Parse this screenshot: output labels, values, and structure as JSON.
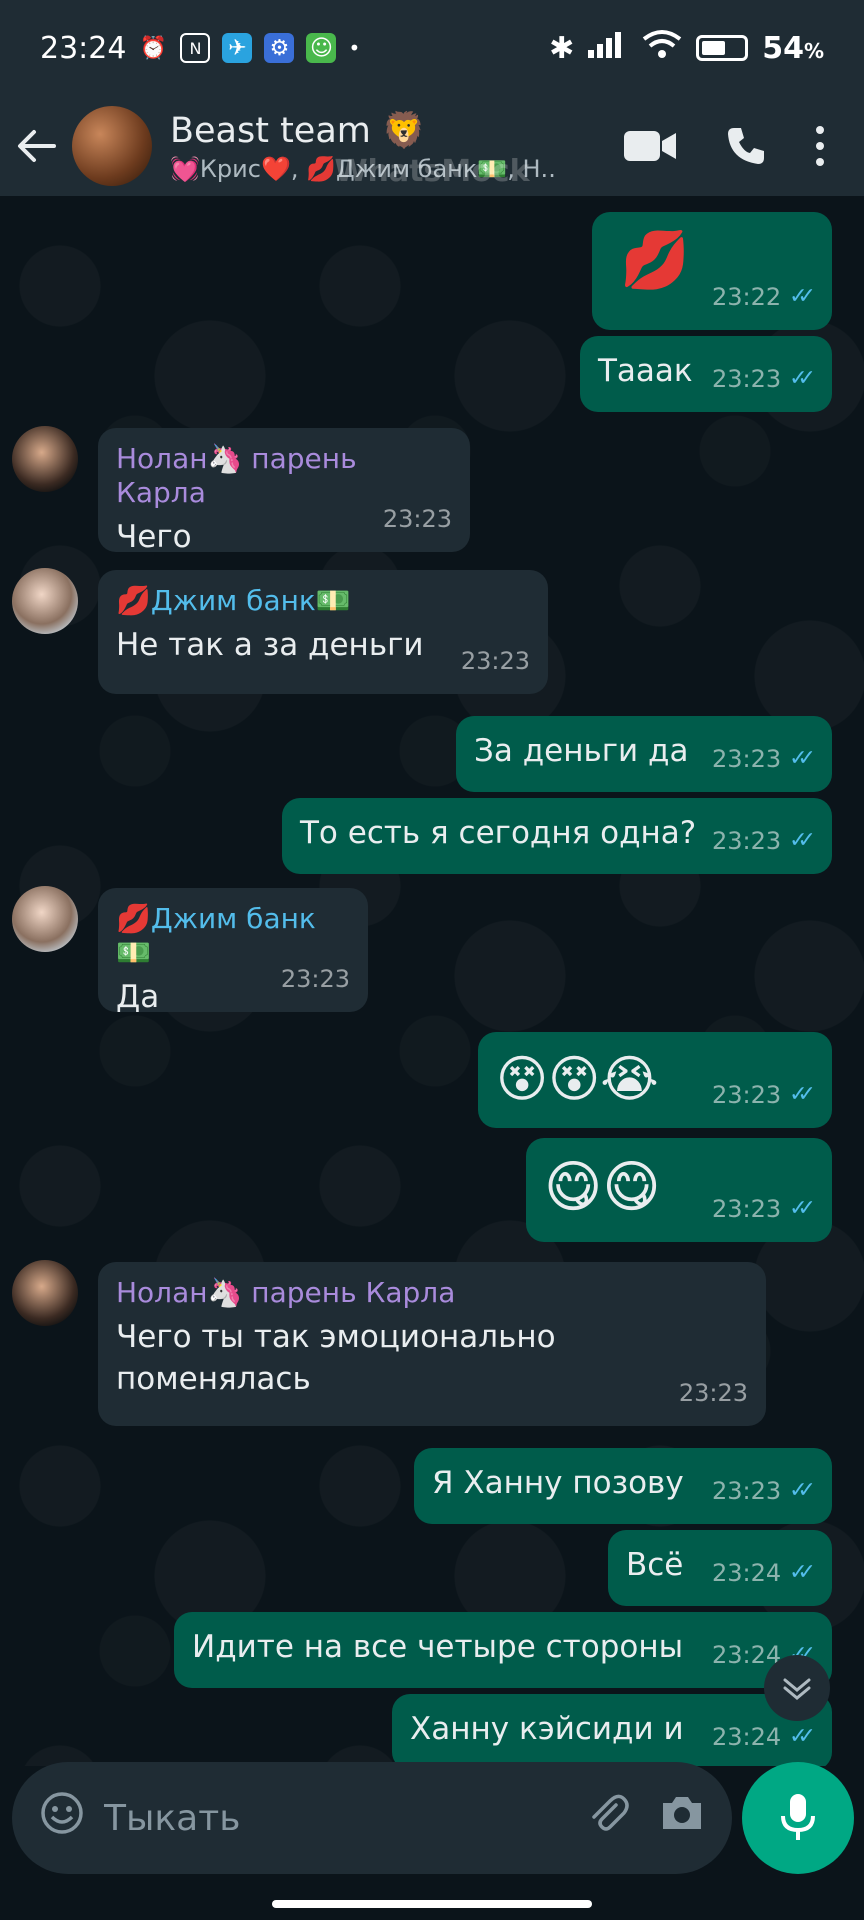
{
  "status_bar": {
    "time": "23:24",
    "battery": "54",
    "battery_unit": "%"
  },
  "header": {
    "title": "Beast team 🦁",
    "subtitle": "💓Крис❤️, 💋Джим банк💵, Н..",
    "watermark": "WhatsMock"
  },
  "messages": [
    {
      "dir": "out",
      "text": "💋",
      "time": "23:22"
    },
    {
      "dir": "out",
      "text": "Тааак",
      "time": "23:23"
    },
    {
      "dir": "in",
      "sender": "Нолан🦄 парень Карла",
      "text": "Чего",
      "time": "23:23"
    },
    {
      "dir": "in",
      "sender": "💋Джим банк💵",
      "text": "Не так а за деньги",
      "time": "23:23"
    },
    {
      "dir": "out",
      "text": "За деньги да",
      "time": "23:23"
    },
    {
      "dir": "out",
      "text": "То есть я сегодня одна?",
      "time": "23:23"
    },
    {
      "dir": "in",
      "sender": "💋Джим банк💵",
      "text": "Да",
      "time": "23:23"
    },
    {
      "dir": "out",
      "text": "😵😵😭",
      "time": "23:23"
    },
    {
      "dir": "out",
      "text": "😋😋",
      "time": "23:23"
    },
    {
      "dir": "in",
      "sender": "Нолан🦄 парень Карла",
      "text": "Чего ты так эмоционально поменялась",
      "time": "23:23"
    },
    {
      "dir": "out",
      "text": "Я Ханну позову",
      "time": "23:23"
    },
    {
      "dir": "out",
      "text": "Всё",
      "time": "23:24"
    },
    {
      "dir": "out",
      "text": "Идите на все четыре стороны",
      "time": "23:24"
    },
    {
      "dir": "out",
      "text": "Ханну кэйсиди и",
      "time": "23:24"
    }
  ],
  "composer": {
    "placeholder": "Тыкать"
  },
  "icons": {
    "back": "arrow-left-icon",
    "video": "video-camera-icon",
    "call": "phone-icon",
    "menu": "more-vert-icon",
    "emoji": "emoji-icon",
    "attach": "paperclip-icon",
    "camera": "camera-icon",
    "mic": "microphone-icon"
  },
  "colors": {
    "header": "#1f2c34",
    "background": "#0b141a",
    "outgoing": "#005c4b",
    "incoming": "#1f2c34",
    "accent": "#00a884",
    "read_ticks": "#53bdeb"
  }
}
